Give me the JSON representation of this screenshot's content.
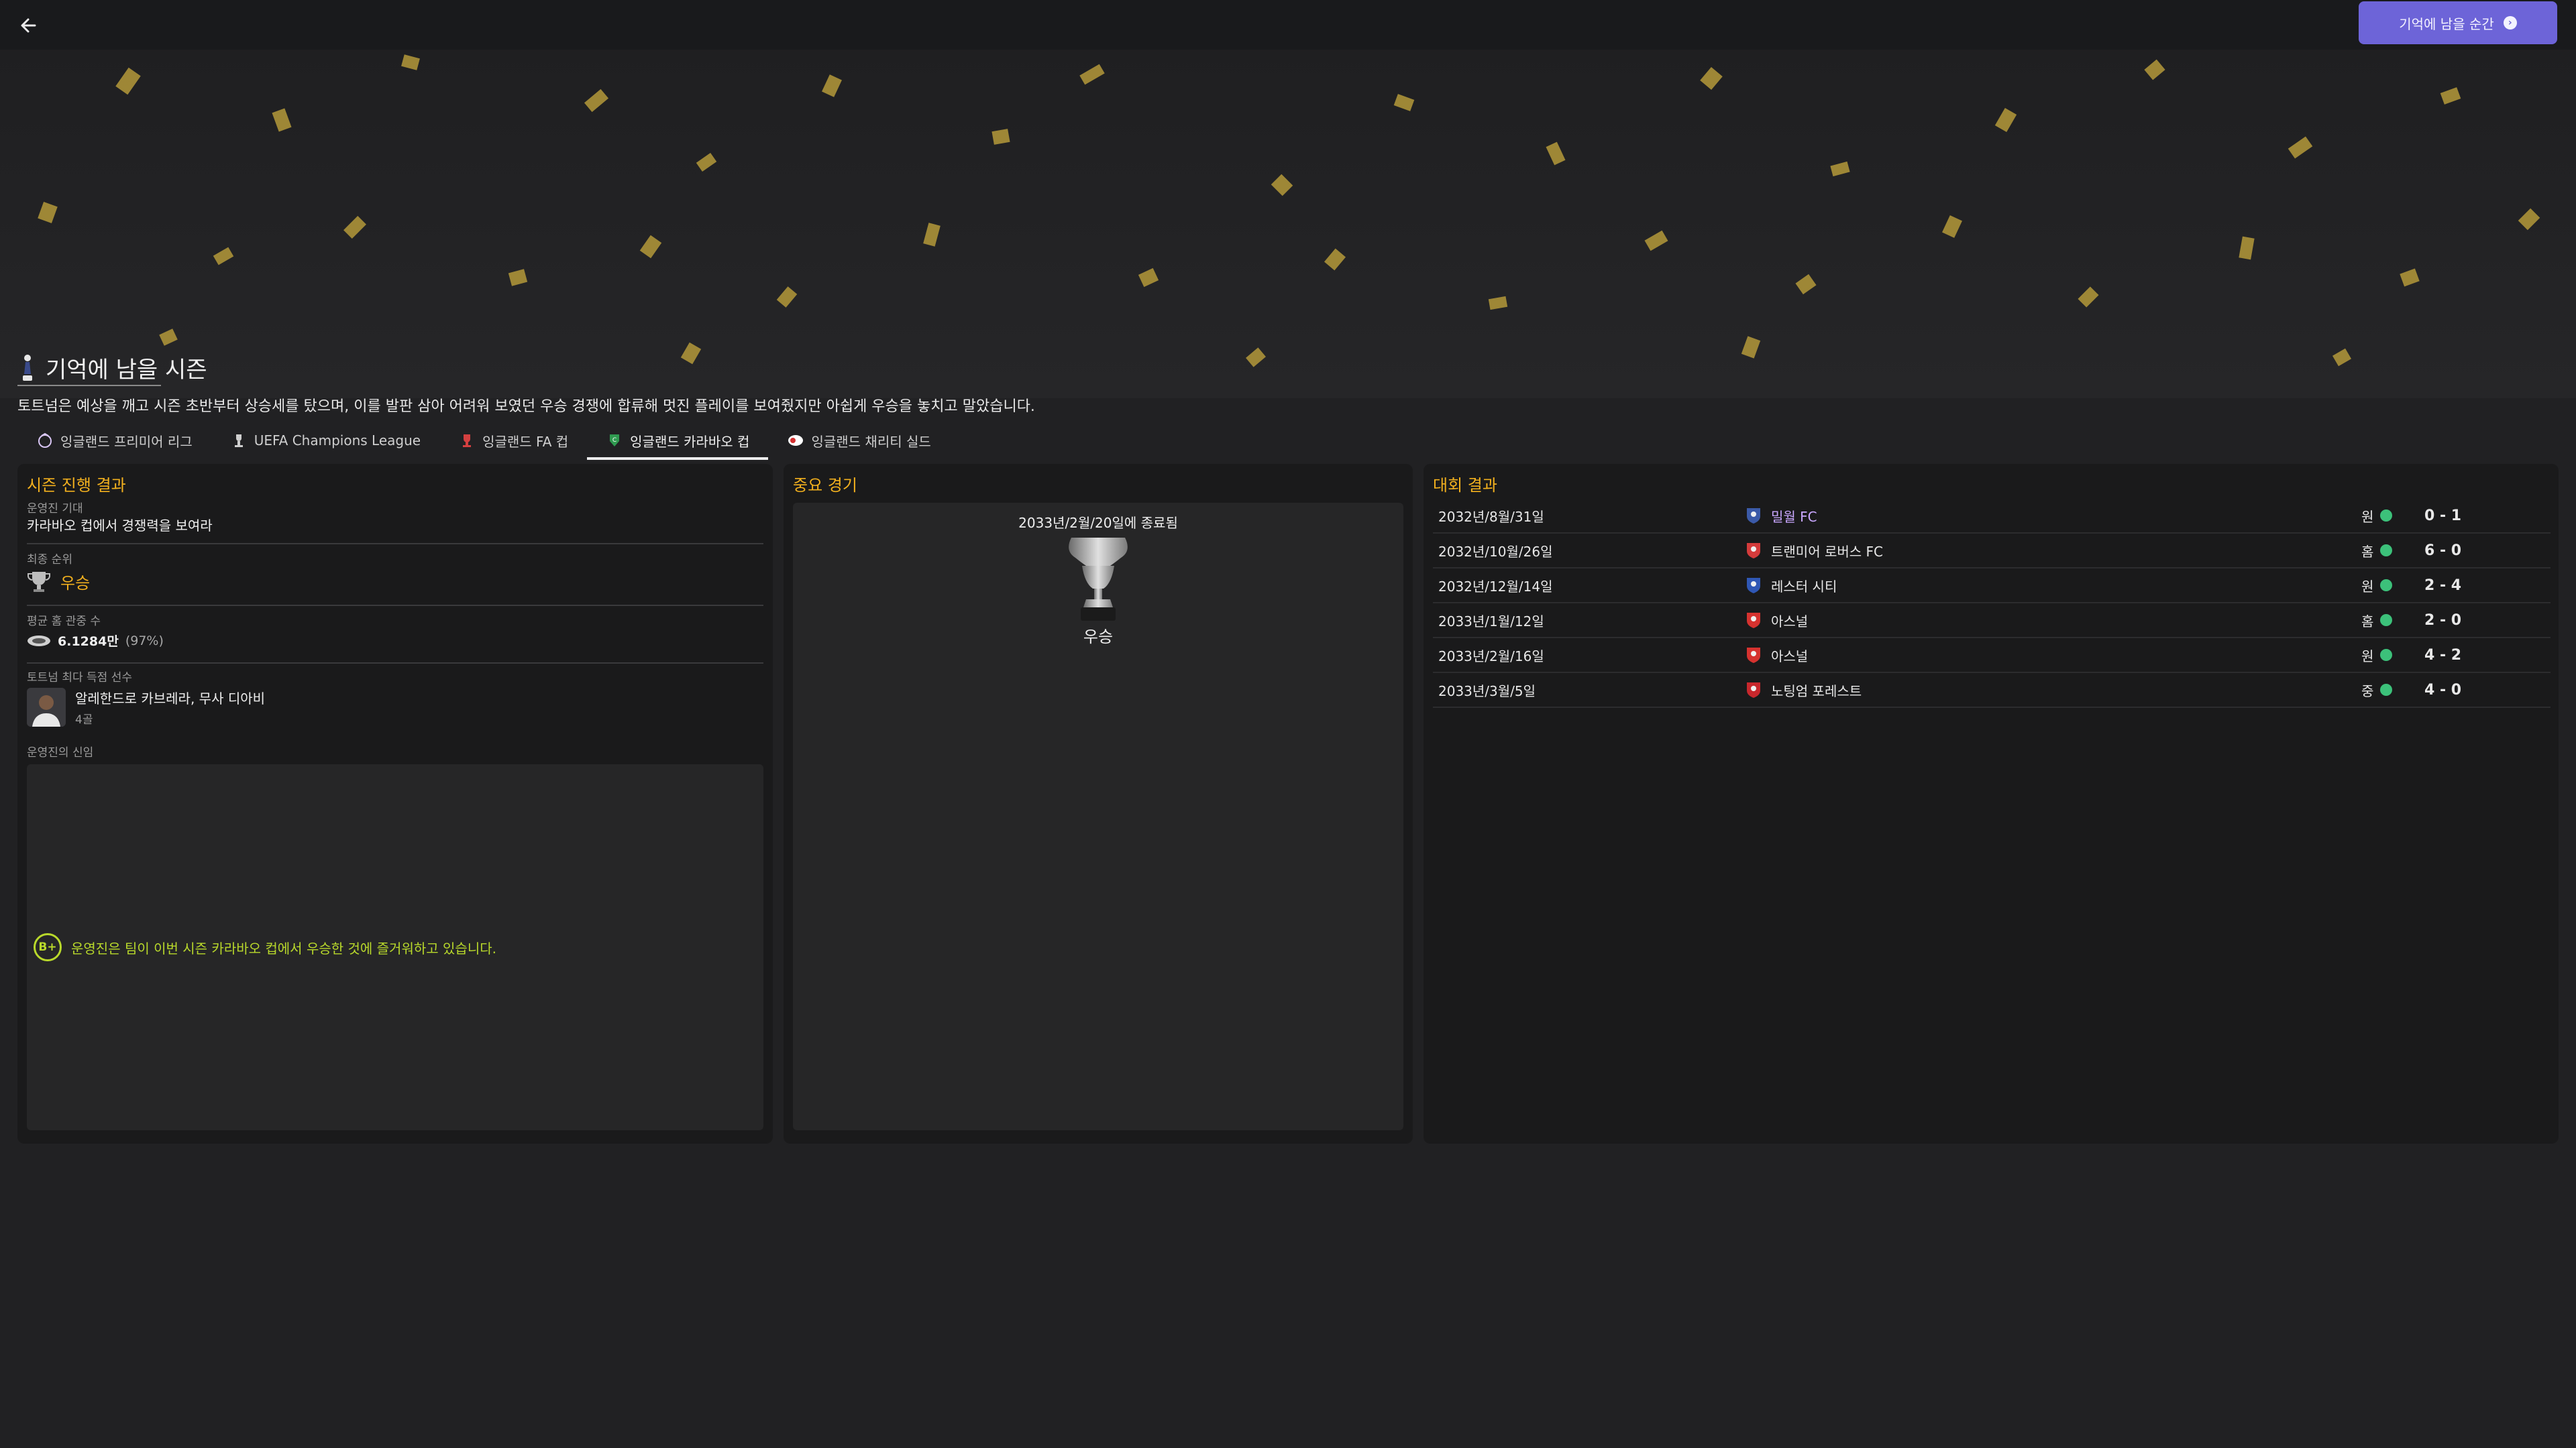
{
  "top_bar": {
    "action_label": "기억에 남을 순간"
  },
  "header": {
    "title": "기억에 남을 시즌",
    "description": "토트넘은 예상을 깨고 시즌 초반부터 상승세를 탔으며, 이를 발판 삼아 어려워 보였던 우승 경쟁에 합류해 멋진 플레이를 보여줬지만 아쉽게 우승을 놓치고 말았습니다."
  },
  "tabs": [
    {
      "label": "잉글랜드 프리미어 리그",
      "icon": "premier-league-icon"
    },
    {
      "label": "UEFA Champions League",
      "icon": "champions-league-icon"
    },
    {
      "label": "잉글랜드 FA 컵",
      "icon": "fa-cup-icon"
    },
    {
      "label": "잉글랜드 카라바오 컵",
      "icon": "carabao-cup-icon",
      "active": true
    },
    {
      "label": "잉글랜드 채리티 실드",
      "icon": "community-shield-icon"
    }
  ],
  "season_progress": {
    "title": "시즌 진행 결과",
    "expectation_label": "운영진 기대",
    "expectation_value": "카라바오 컵에서 경쟁력을 보여라",
    "final_position_label": "최종 순위",
    "final_position_value": "우승",
    "attendance_label": "평균 홈 관중 수",
    "attendance_value": "6.1284만",
    "attendance_pct": "(97%)",
    "top_scorer_label": "토트넘 최다 득점 선수",
    "top_scorer_names": "알레한드로 카브레라, 무사 디아비",
    "top_scorer_goals": "4골",
    "confidence_label": "운영진의 신임",
    "confidence_grade": "B+",
    "confidence_text": "운영진은 팀이 이번 시즌 카라바오 컵에서 우승한 것에 즐거워하고 있습니다."
  },
  "key_match": {
    "title": "중요 경기",
    "date_text": "2033년/2월/20일에 종료됨",
    "result_text": "우승"
  },
  "competition_results": {
    "title": "대회 결과",
    "rows": [
      {
        "date": "2032년/8월/31일",
        "opponent": "밀월 FC",
        "venue": "원",
        "score": "0 - 1",
        "highlight": true,
        "crest_color": "#3b5aa8"
      },
      {
        "date": "2032년/10월/26일",
        "opponent": "트랜미어 로버스 FC",
        "venue": "홈",
        "score": "6 - 0",
        "highlight": false,
        "crest_color": "#d43b3b"
      },
      {
        "date": "2032년/12월/14일",
        "opponent": "레스터 시티",
        "venue": "원",
        "score": "2 - 4",
        "highlight": false,
        "crest_color": "#2f57b5"
      },
      {
        "date": "2033년/1월/12일",
        "opponent": "아스널",
        "venue": "홈",
        "score": "2 - 0",
        "highlight": false,
        "crest_color": "#d6322f"
      },
      {
        "date": "2033년/2월/16일",
        "opponent": "아스널",
        "venue": "원",
        "score": "4 - 2",
        "highlight": false,
        "crest_color": "#d6322f"
      },
      {
        "date": "2033년/3월/5일",
        "opponent": "노팅엄 포레스트",
        "venue": "중",
        "score": "4 - 0",
        "highlight": false,
        "crest_color": "#c8272c"
      }
    ]
  },
  "colors": {
    "accent": "#6d64d8",
    "heading": "#f2b01e",
    "grade": "#b9d92b",
    "win_dot": "#3cc17a",
    "highlight_link": "#c9a7ff"
  }
}
